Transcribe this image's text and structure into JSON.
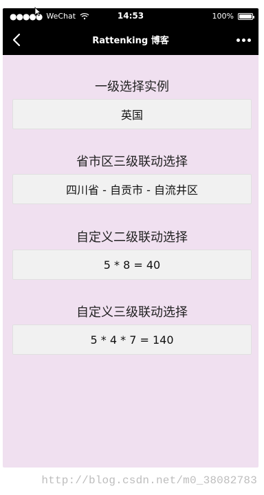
{
  "status_bar": {
    "carrier": "WeChat",
    "signal_dots": "●●●●●",
    "time": "14:53",
    "battery_percent_text": "100%",
    "battery_level": 1.0
  },
  "nav": {
    "title": "Rattenking 博客",
    "back_icon": "chevron-left-icon",
    "more_icon": "more-dots-icon"
  },
  "sections": [
    {
      "title": "一级选择实例",
      "value": "英国"
    },
    {
      "title": "省市区三级联动选择",
      "value": "四川省 - 自贡市 - 自流井区"
    },
    {
      "title": "自定义二级联动选择",
      "value": "5 * 8 = 40"
    },
    {
      "title": "自定义三级联动选择",
      "value": "5 * 4 * 7 = 140"
    }
  ],
  "watermark": "http://blog.csdn.net/m0_38082783",
  "colors": {
    "background": "#f0e0f0",
    "navbar": "#000000",
    "picker_background": "#f1f1f1"
  }
}
